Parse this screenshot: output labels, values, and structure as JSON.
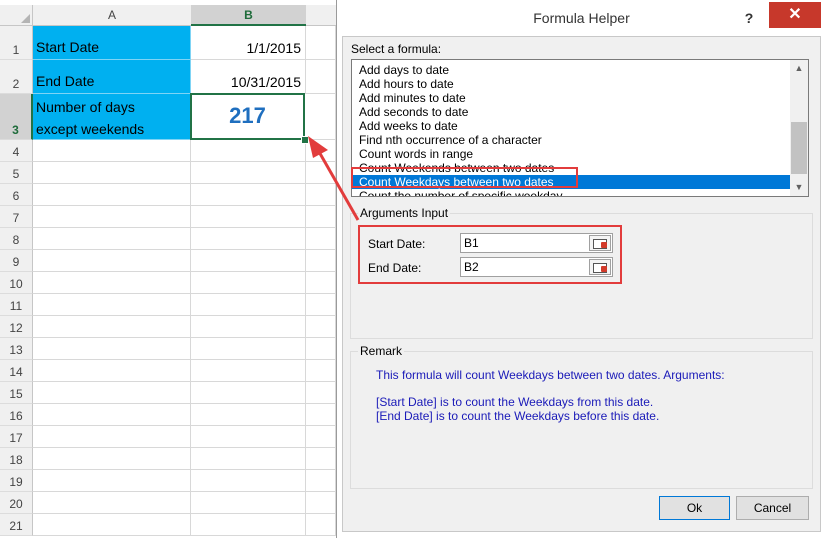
{
  "sheet": {
    "columns": [
      "A",
      "B"
    ],
    "rows": [
      "1",
      "2",
      "3",
      "4",
      "5",
      "6",
      "7",
      "8",
      "9",
      "10",
      "11",
      "12",
      "13",
      "14",
      "15",
      "16",
      "17",
      "18",
      "19",
      "20",
      "21"
    ],
    "cells": {
      "a1": "Start Date",
      "b1": "1/1/2015",
      "a2": "End Date",
      "b2": "10/31/2015",
      "a3_line1": "Number of days",
      "a3_line2": "except weekends",
      "b3": "217"
    },
    "colors": {
      "header_fill": "#00b0f0",
      "result_text": "#1f6fbf",
      "selection": "#217346"
    }
  },
  "dialog": {
    "title": "Formula Helper",
    "help_label": "?",
    "close_label": "✕",
    "select_label": "Select a formula:",
    "formulas": [
      "Add days to date",
      "Add hours to date",
      "Add minutes to date",
      "Add seconds to date",
      "Add weeks to date",
      "Find nth occurrence of a character",
      "Count words in range",
      "Count Weekends between two dates",
      "Count Weekdays between two dates",
      "Count the number of specific weekday"
    ],
    "selected_index": 8,
    "arguments_label": "Arguments Input",
    "start_date_label": "Start Date:",
    "start_date_value": "B1",
    "end_date_label": "End Date:",
    "end_date_value": "B2",
    "remark_label": "Remark",
    "remark_line1": "This formula will count Weekdays between two dates. Arguments:",
    "remark_line2": "[Start Date] is to count the Weekdays from this date.",
    "remark_line3": "[End Date] is to count the Weekdays before this date.",
    "ok_label": "Ok",
    "cancel_label": "Cancel",
    "colors": {
      "selection": "#0078d7",
      "remark_text": "#1a1ab8",
      "highlight": "#e23c3c",
      "close": "#c7382b"
    }
  }
}
